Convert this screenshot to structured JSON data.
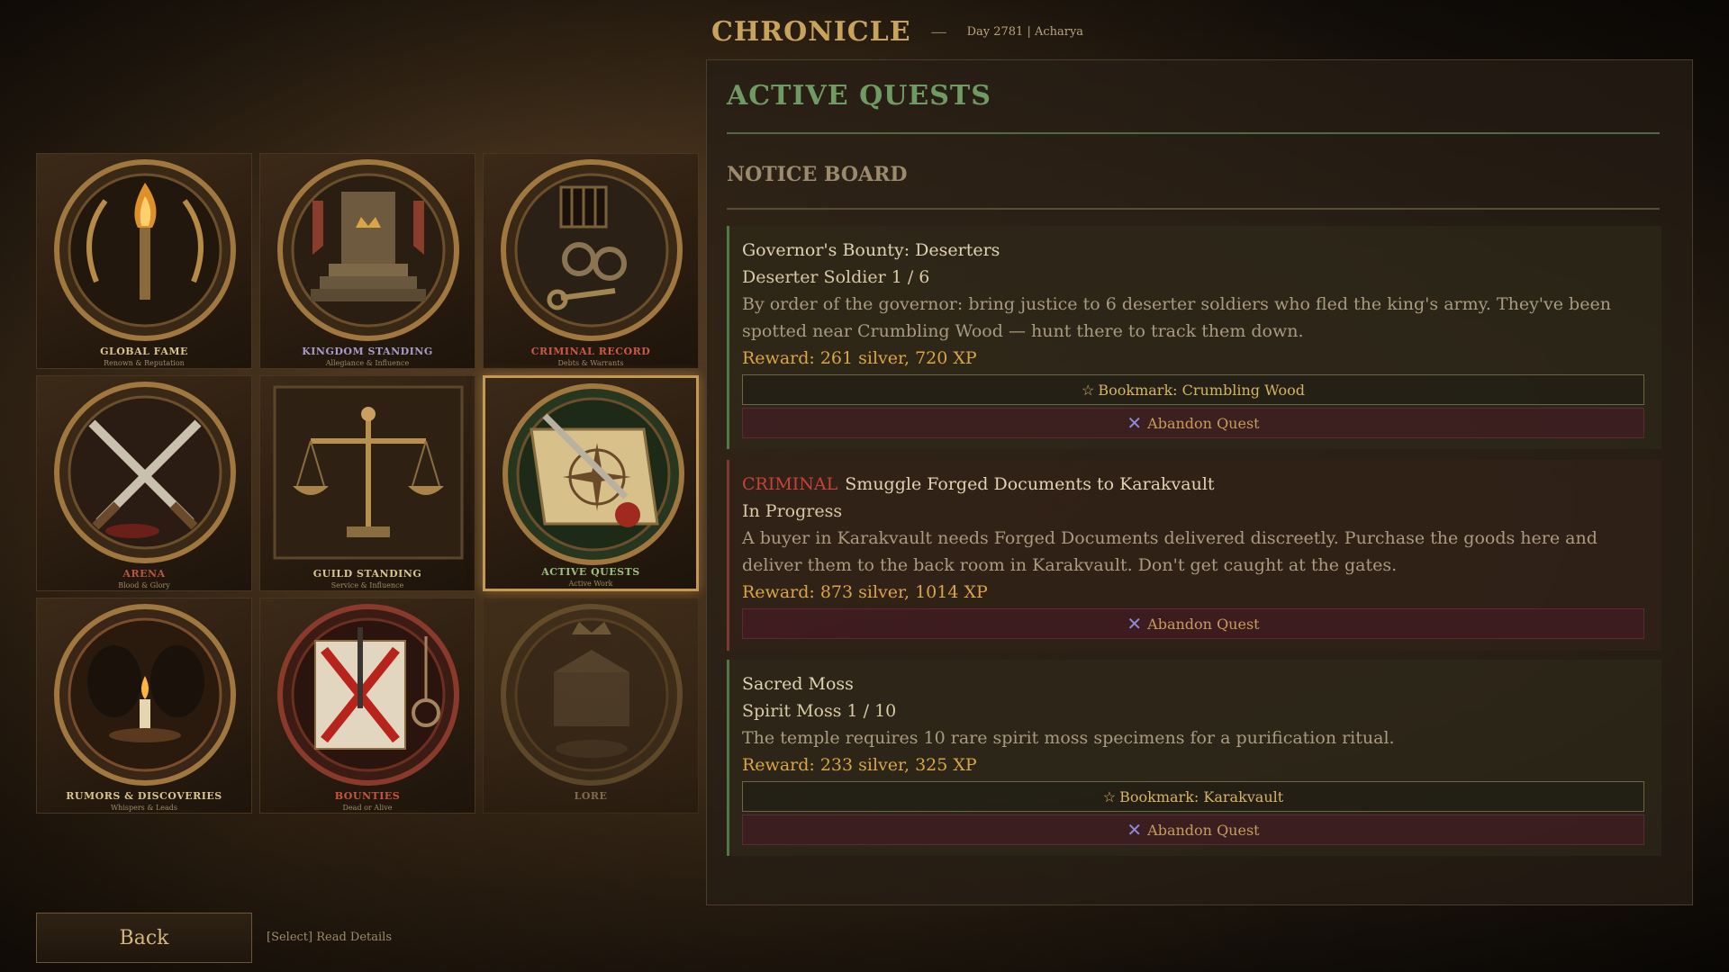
{
  "header": {
    "title": "CHRONICLE",
    "separator": "—",
    "meta": "Day 2781 | Acharya"
  },
  "categories": [
    {
      "label": "Global Fame",
      "sub": "Renown & Reputation",
      "icon": "torch-laurel-icon"
    },
    {
      "label": "Kingdom Standing",
      "sub": "Allegiance & Influence",
      "icon": "throne-icon"
    },
    {
      "label": "Criminal Record",
      "sub": "Debts & Warrants",
      "icon": "shackles-icon"
    },
    {
      "label": "Arena",
      "sub": "Blood & Glory",
      "icon": "crossed-swords-icon"
    },
    {
      "label": "Guild Standing",
      "sub": "Service & Influence",
      "icon": "scales-icon"
    },
    {
      "label": "Active Quests",
      "sub": "Active Work",
      "icon": "scroll-compass-icon"
    },
    {
      "label": "Rumors & Discoveries",
      "sub": "Whispers & Leads",
      "icon": "candle-icon"
    },
    {
      "label": "Bounties",
      "sub": "Dead or Alive",
      "icon": "wanted-poster-icon"
    },
    {
      "label": "Lore",
      "sub": "",
      "icon": "crest-icon"
    }
  ],
  "back_label": "Back",
  "hint": "[Select] Read Details",
  "panel": {
    "title": "ACTIVE QUESTS",
    "section": "NOTICE BOARD",
    "quests": [
      {
        "tag": "",
        "title": "Governor's Bounty: Deserters",
        "progress": "Deserter Soldier  1 / 6",
        "desc": "By order of the governor: bring justice to 6 deserter soldiers who fled the king's army. They've been spotted near Crumbling Wood — hunt there to track them down.",
        "reward": "Reward: 261 silver, 720 XP",
        "bookmark": "Bookmark: Crumbling Wood",
        "abandon": "Abandon Quest"
      },
      {
        "tag": "CRIMINAL",
        "title": "Smuggle Forged Documents to Karakvault",
        "progress": "In Progress",
        "desc": "A buyer in Karakvault needs Forged Documents delivered discreetly. Purchase the goods here and deliver them to the back room in Karakvault. Don't get caught at the gates.",
        "reward": "Reward: 873 silver, 1014 XP",
        "bookmark": "",
        "abandon": "Abandon Quest"
      },
      {
        "tag": "",
        "title": "Sacred Moss",
        "progress": "Spirit Moss  1 / 10",
        "desc": "The temple requires 10 rare spirit moss specimens for a purification ritual.",
        "reward": "Reward: 233 silver, 325 XP",
        "bookmark": "Bookmark: Karakvault",
        "abandon": "Abandon Quest"
      }
    ]
  },
  "colors": {
    "accent_green": "#6f9a63",
    "reward_gold": "#d9a545",
    "criminal_red": "#c6423a",
    "abandon_x": "#8d8ad6"
  }
}
